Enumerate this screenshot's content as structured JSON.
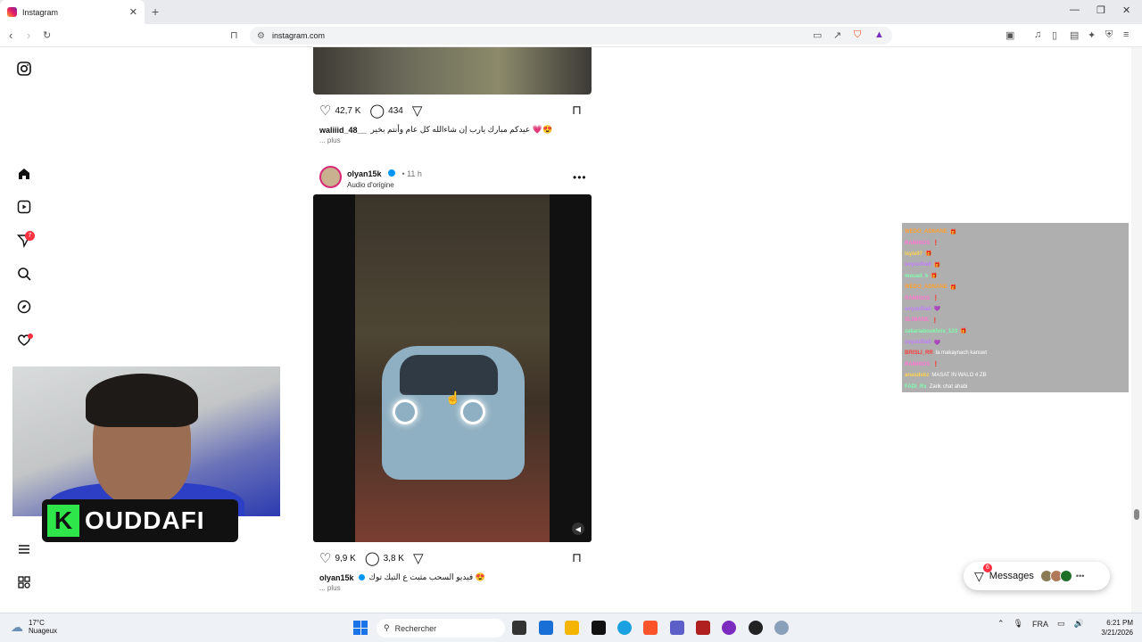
{
  "browser": {
    "tab_title": "Instagram",
    "tab_close": "✕",
    "new_tab": "+",
    "url": "instagram.com"
  },
  "sidebar": {
    "notifications_badge": "7"
  },
  "feed": {
    "post1": {
      "likes": "42,7 K",
      "comments": "434",
      "username": "waliiid_48__",
      "caption": "عيدكم مبارك يارب إن شاءالله كل عام وأنتم بخير 💗😍",
      "more": "... plus"
    },
    "post2": {
      "username": "olyan15k",
      "time": "• 11 h",
      "audio": "Audio d'origine",
      "likes": "9,9 K",
      "comments": "3,8 K",
      "caption": "فيديو السحب مثبت ع التيك توك 😍",
      "more": "... plus",
      "menu": "•••"
    }
  },
  "overlay": {
    "streamer_initial": "K",
    "streamer_name": "OUDDAFI"
  },
  "chat": [
    {
      "user": "WEDO_ADNANE",
      "color": "#ff9f2e",
      "msg": "🎁"
    },
    {
      "user": "RAMINOS",
      "color": "#ff77d0",
      "msg": "❗"
    },
    {
      "user": "layla97",
      "color": "#ffd34d",
      "msg": "🎁"
    },
    {
      "user": "soyoufilali",
      "color": "#c27cff",
      "msg": "🎁"
    },
    {
      "user": "mouad_k",
      "color": "#7dffb0",
      "msg": "🎁"
    },
    {
      "user": "WEDO_ADNANE",
      "color": "#ff9f2e",
      "msg": "🎁"
    },
    {
      "user": "RAMINOS",
      "color": "#ff77d0",
      "msg": "❗"
    },
    {
      "user": "soyoufilali",
      "color": "#c27cff",
      "msg": "💜"
    },
    {
      "user": "SLIMANE",
      "color": "#ff77d0",
      "msg": "❗"
    },
    {
      "user": "zakariaboukhris_123",
      "color": "#7dffb0",
      "msg": "🎁"
    },
    {
      "user": "soyoufilali",
      "color": "#c27cff",
      "msg": "💜"
    },
    {
      "user": "BRISLI_RR",
      "color": "#ff3b3b",
      "msg": "la makaynach kanswt"
    },
    {
      "user": "RAMINOS",
      "color": "#ff77d0",
      "msg": "❗"
    },
    {
      "user": "anasdebz",
      "color": "#ffd34d",
      "msg": "MASAT IN WALO 4 ZB"
    },
    {
      "user": "FADI_Rx",
      "color": "#7dffb0",
      "msg": "Zarik chat ahabi"
    }
  ],
  "messages": {
    "label": "Messages",
    "badge": "6",
    "more": "•••"
  },
  "taskbar": {
    "temp": "17°C",
    "weather": "Nuageux",
    "search_placeholder": "Rechercher",
    "lang": "FRA",
    "time": "6:21 PM",
    "date": "3/21/2026"
  },
  "colors": {
    "accent_blue": "#0095f6",
    "notification_red": "#ff3040",
    "brave_orange": "#fb542b"
  },
  "icons": {
    "sidebar": [
      "instagram-logo-icon",
      "home-icon",
      "reels-icon",
      "direct-icon",
      "search-icon",
      "explore-icon",
      "heart-icon",
      "menu-icon",
      "more-icon"
    ]
  }
}
